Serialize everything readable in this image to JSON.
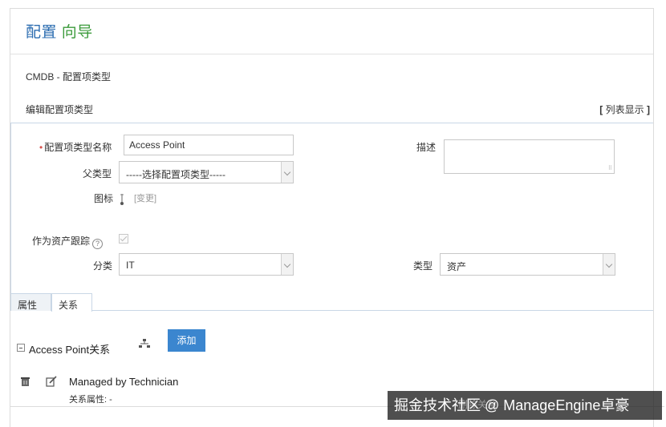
{
  "wizard": {
    "title_part1": "配置",
    "title_part2": "向导"
  },
  "breadcrumb": "CMDB - 配置项类型",
  "section": {
    "title": "编辑配置项类型",
    "list_view_label": "列表显示"
  },
  "form": {
    "name_label": "配置项类型名称",
    "name_value": "Access Point",
    "description_label": "描述",
    "description_value": "",
    "parent_label": "父类型",
    "parent_value": "-----选择配置项类型-----",
    "icon_label": "图标",
    "icon_change_label": "[变更]",
    "track_as_asset_label": "作为资产跟踪",
    "track_as_asset_checked": true,
    "help_glyph": "?",
    "category_label": "分类",
    "category_value": "IT",
    "type_label": "类型",
    "type_value": "资产"
  },
  "tabs": [
    {
      "label": "属性",
      "active": false
    },
    {
      "label": "关系",
      "active": true
    }
  ],
  "relationships": {
    "group_title": "Access Point关系",
    "add_button": "添加",
    "items": [
      {
        "name": "Managed by Technician",
        "attributes": "关系属性: -"
      }
    ]
  },
  "watermark": {
    "text": "掘金技术社区 @ ManageEngine卓豪",
    "ghost_text": "删除关系"
  },
  "colors": {
    "accent_blue": "#3b86cf",
    "title_blue": "#2b6cb0",
    "title_green": "#3c9b3c",
    "required": "#d9534f"
  }
}
